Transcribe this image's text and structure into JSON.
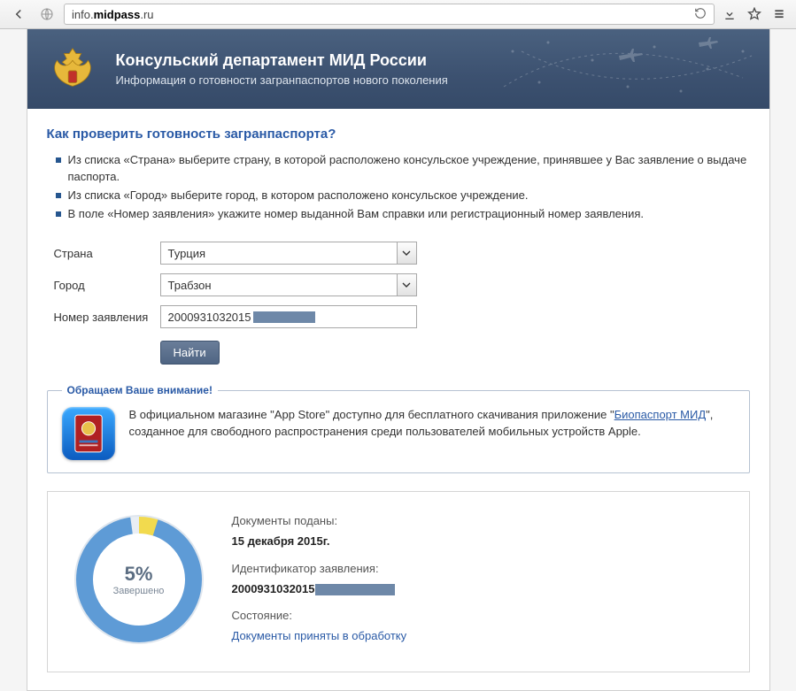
{
  "browser": {
    "url_plain": "info.",
    "url_domain": "midpass",
    "url_tld": ".ru"
  },
  "header": {
    "title": "Консульский департамент МИД России",
    "subtitle": "Информация о готовности загранпаспортов нового поколения"
  },
  "section_title": "Как проверить готовность загранпаспорта?",
  "instructions": [
    "Из списка «Страна» выберите страну, в которой расположено консульское учреждение, принявшее у Вас заявление о выдаче паспорта.",
    "Из списка «Город» выберите город, в котором расположено консульское учреждение.",
    "В поле «Номер заявления» укажите номер выданной Вам справки или регистрационный номер заявления."
  ],
  "form": {
    "country_label": "Страна",
    "country_value": "Турция",
    "city_label": "Город",
    "city_value": "Трабзон",
    "appnum_label": "Номер заявления",
    "appnum_value": "2000931032015",
    "find_button": "Найти"
  },
  "notice": {
    "legend": "Обращаем Ваше внимание!",
    "text_before": "В официальном магазине \"App Store\" доступно для бесплатного скачивания приложение \"",
    "link_text": "Биопаспорт МИД",
    "text_after": "\", созданное для свободного распространения среди пользователей мобильных устройств Apple."
  },
  "result": {
    "gauge_percent": "5%",
    "gauge_label": "Завершено",
    "docs_submitted_label": "Документы поданы:",
    "docs_submitted_value": "15 декабря 2015г.",
    "app_id_label": "Идентификатор заявления:",
    "app_id_value": "2000931032015",
    "status_label": "Состояние:",
    "status_value": "Документы приняты в обработку"
  }
}
